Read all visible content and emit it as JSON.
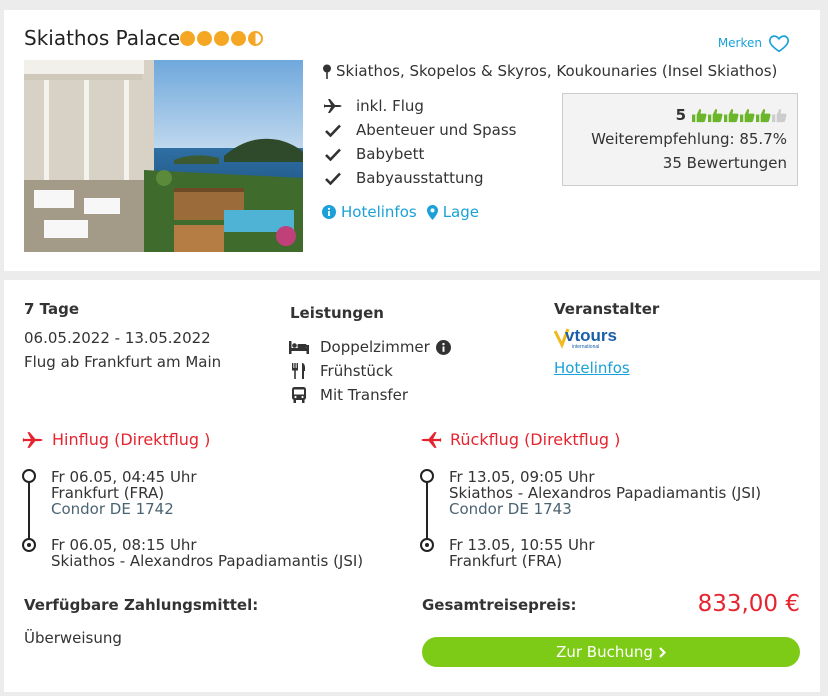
{
  "hotel": {
    "name": "Skiathos Palace",
    "stars": 4.5,
    "merken_label": "Merken",
    "location": "Skiathos, Skopelos & Skyros, Koukounaries (Insel Skiathos)",
    "features": [
      "inkl. Flug",
      "Abenteuer und Spass",
      "Babybett",
      "Babyausstattung"
    ],
    "links": {
      "hotelinfos": "Hotelinfos",
      "lage": "Lage"
    },
    "rating": {
      "score": "5",
      "thumbs": 4.5,
      "recommendation": "Weiterempfehlung: 85.7%",
      "reviews": "35 Bewertungen"
    }
  },
  "offer": {
    "duration": "7 Tage",
    "dates": "06.05.2022 - 13.05.2022",
    "departure": "Flug ab Frankfurt am Main",
    "services_title": "Leistungen",
    "services": [
      "Doppelzimmer",
      "Frühstück",
      "Mit Transfer"
    ],
    "operator_title": "Veranstalter",
    "operator_logo": "vtours",
    "operator_logo_sub": "international",
    "operator_link": "Hotelinfos",
    "outbound": {
      "title": "Hinflug (Direktflug )",
      "dep_time": "Fr 06.05, 04:45 Uhr",
      "dep_airport": "Frankfurt (FRA)",
      "carrier": "Condor DE 1742",
      "arr_time": "Fr 06.05, 08:15 Uhr",
      "arr_airport": "Skiathos - Alexandros Papadiamantis (JSI)"
    },
    "return": {
      "title": "Rückflug (Direktflug )",
      "dep_time": "Fr 13.05, 09:05 Uhr",
      "dep_airport": "Skiathos - Alexandros Papadiamantis (JSI)",
      "carrier": "Condor DE 1743",
      "arr_time": "Fr 13.05, 10:55 Uhr",
      "arr_airport": "Frankfurt (FRA)"
    },
    "payment_title": "Verfügbare Zahlungsmittel:",
    "payment_value": "Überweisung",
    "total_title": "Gesamtreisepreis:",
    "price": "833,00 €",
    "book_button": "Zur Buchung"
  },
  "colors": {
    "accent": "#1ba1d8",
    "price": "#e6242f",
    "button": "#7dcb16",
    "stars": "#f5a623",
    "thumbs": "#6bb52b"
  }
}
